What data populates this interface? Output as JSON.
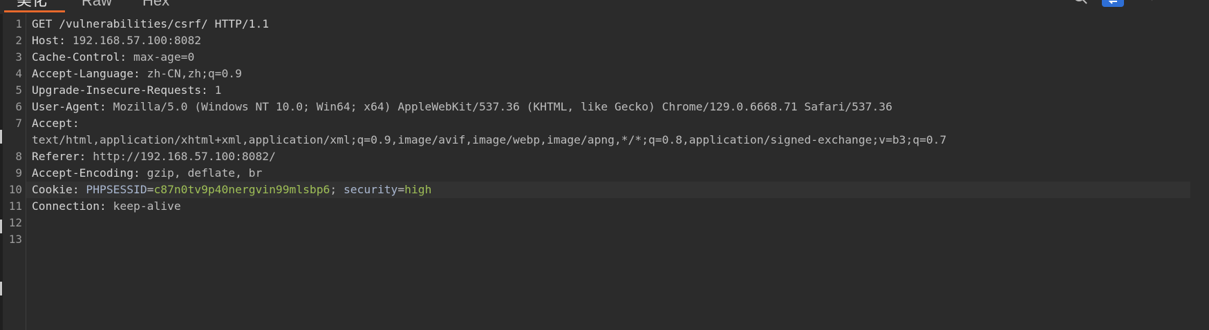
{
  "tabs": [
    {
      "label": "美化",
      "active": true
    },
    {
      "label": "Raw",
      "active": false
    },
    {
      "label": "Hex",
      "active": false
    }
  ],
  "toolbar": {
    "icons": [
      "search-icon",
      "wrap-toggle-icon",
      "newline-icon",
      "menu-icon"
    ],
    "accent_color": "#2e6fd6"
  },
  "colors": {
    "background": "#2b2b2b",
    "active_tab_underline": "#e8692c",
    "cookie_value": "#9fbf57"
  },
  "editor": {
    "highlighted_line": 10,
    "lines": [
      {
        "num": "1",
        "key": "GET /vulnerabilities/csrf/ HTTP/1.1",
        "value": ""
      },
      {
        "num": "2",
        "key": "Host:",
        "value": " 192.168.57.100:8082"
      },
      {
        "num": "3",
        "key": "Cache-Control:",
        "value": " max-age=0"
      },
      {
        "num": "4",
        "key": "Accept-Language:",
        "value": " zh-CN,zh;q=0.9"
      },
      {
        "num": "5",
        "key": "Upgrade-Insecure-Requests:",
        "value": " 1"
      },
      {
        "num": "6",
        "key": "User-Agent:",
        "value": " Mozilla/5.0 (Windows NT 10.0; Win64; x64) AppleWebKit/537.36 (KHTML, like Gecko) Chrome/129.0.6668.71 Safari/537.36"
      },
      {
        "num": "7",
        "key": "Accept:",
        "value": ""
      },
      {
        "num": "",
        "key": "",
        "value": "text/html,application/xhtml+xml,application/xml;q=0.9,image/avif,image/webp,image/apng,*/*;q=0.8,application/signed-exchange;v=b3;q=0.7"
      },
      {
        "num": "8",
        "key": "Referer:",
        "value": " http://192.168.57.100:8082/"
      },
      {
        "num": "9",
        "key": "Accept-Encoding:",
        "value": " gzip, deflate, br"
      },
      {
        "num": "10",
        "key": "Cookie:",
        "cookie": {
          "name1": " PHPSESSID",
          "eq1": "=",
          "val1": "c87n0tv9p40nergvin99mlsbp6",
          "sep": "; ",
          "name2": "security",
          "eq2": "=",
          "val2": "high"
        }
      },
      {
        "num": "11",
        "key": "Connection:",
        "value": " keep-alive"
      },
      {
        "num": "12",
        "key": "",
        "value": ""
      },
      {
        "num": "13",
        "key": "",
        "value": ""
      }
    ]
  }
}
